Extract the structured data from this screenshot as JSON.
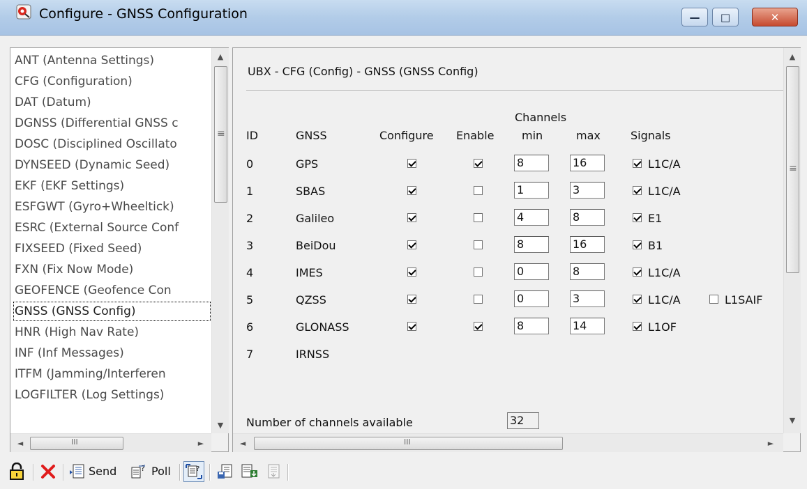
{
  "window": {
    "title": "Configure - GNSS Configuration",
    "minimize_glyph": "—",
    "restore_glyph": "□",
    "close_glyph": "✕"
  },
  "sidebar": {
    "items": [
      "ANT (Antenna Settings)",
      "CFG (Configuration)",
      "DAT (Datum)",
      "DGNSS (Differential GNSS c",
      "DOSC (Disciplined Oscillato",
      "DYNSEED (Dynamic Seed)",
      "EKF (EKF Settings)",
      "ESFGWT (Gyro+Wheeltick)",
      "ESRC (External Source Conf",
      "FIXSEED (Fixed Seed)",
      "FXN (Fix Now Mode)",
      "GEOFENCE (Geofence Con",
      "GNSS (GNSS Config)",
      "HNR (High Nav Rate)",
      "INF (Inf Messages)",
      "ITFM (Jamming/Interferen",
      "LOGFILTER (Log Settings)"
    ],
    "selected_index": 12
  },
  "panel": {
    "header": "UBX - CFG (Config) - GNSS (GNSS Config)",
    "columns": {
      "id": "ID",
      "gnss": "GNSS",
      "configure": "Configure",
      "enable": "Enable",
      "channels": "Channels",
      "min": "min",
      "max": "max",
      "signals": "Signals"
    },
    "rows": [
      {
        "id": "0",
        "gnss": "GPS",
        "configure": true,
        "enable": true,
        "min": "8",
        "max": "16",
        "signals": [
          {
            "label": "L1C/A",
            "checked": true
          }
        ]
      },
      {
        "id": "1",
        "gnss": "SBAS",
        "configure": true,
        "enable": false,
        "min": "1",
        "max": "3",
        "signals": [
          {
            "label": "L1C/A",
            "checked": true
          }
        ]
      },
      {
        "id": "2",
        "gnss": "Galileo",
        "configure": true,
        "enable": false,
        "min": "4",
        "max": "8",
        "signals": [
          {
            "label": "E1",
            "checked": true
          }
        ]
      },
      {
        "id": "3",
        "gnss": "BeiDou",
        "configure": true,
        "enable": false,
        "min": "8",
        "max": "16",
        "signals": [
          {
            "label": "B1",
            "checked": true
          }
        ]
      },
      {
        "id": "4",
        "gnss": "IMES",
        "configure": true,
        "enable": false,
        "min": "0",
        "max": "8",
        "signals": [
          {
            "label": "L1C/A",
            "checked": true
          }
        ]
      },
      {
        "id": "5",
        "gnss": "QZSS",
        "configure": true,
        "enable": false,
        "min": "0",
        "max": "3",
        "signals": [
          {
            "label": "L1C/A",
            "checked": true
          },
          {
            "label": "L1SAIF",
            "checked": false
          }
        ]
      },
      {
        "id": "6",
        "gnss": "GLONASS",
        "configure": true,
        "enable": true,
        "min": "8",
        "max": "14",
        "signals": [
          {
            "label": "L1OF",
            "checked": true
          }
        ]
      },
      {
        "id": "7",
        "gnss": "IRNSS",
        "configure": null,
        "enable": null,
        "min": null,
        "max": null,
        "signals": []
      }
    ],
    "channels_available_label": "Number of channels available",
    "channels_available_value": "32"
  },
  "scrollbars": {
    "up": "▲",
    "down": "▼",
    "left": "◄",
    "right": "►",
    "grip_v": "≡",
    "grip_h": "III"
  },
  "toolbar": {
    "send_label": "Send",
    "poll_label": "Poll"
  }
}
